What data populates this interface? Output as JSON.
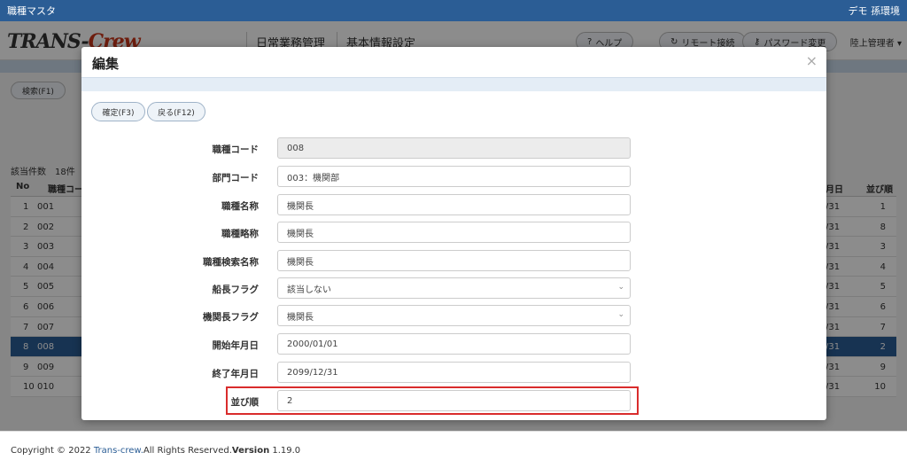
{
  "window": {
    "title": "職種マスタ",
    "env": "デモ 孫環境"
  },
  "header": {
    "logo_a": "TRANS-",
    "logo_b": "Crew",
    "nav": [
      "日常業務管理",
      "基本情報設定"
    ],
    "buttons": [
      {
        "icon": "help-icon",
        "glyph": "?",
        "label": "ヘルプ"
      },
      {
        "icon": "refresh-icon",
        "glyph": "↻",
        "label": "リモート接続"
      },
      {
        "icon": "key-icon",
        "glyph": "⚷",
        "label": "パスワード変更"
      }
    ],
    "user": "陸上管理者 ▾"
  },
  "background": {
    "search_button": "検索(F1)",
    "count": "該当件数　18件",
    "columns": {
      "no": "No",
      "code": "職種コー",
      "end": "月日",
      "order": "並び順"
    },
    "rows": [
      {
        "no": "1",
        "code": "001",
        "end": "/31",
        "order": "1"
      },
      {
        "no": "2",
        "code": "002",
        "end": "/31",
        "order": "8"
      },
      {
        "no": "3",
        "code": "003",
        "end": "/31",
        "order": "3"
      },
      {
        "no": "4",
        "code": "004",
        "end": "/31",
        "order": "4"
      },
      {
        "no": "5",
        "code": "005",
        "end": "/31",
        "order": "5"
      },
      {
        "no": "6",
        "code": "006",
        "end": "/31",
        "order": "6"
      },
      {
        "no": "7",
        "code": "007",
        "end": "/31",
        "order": "7"
      },
      {
        "no": "8",
        "code": "008",
        "end": "/31",
        "order": "2",
        "selected": true
      },
      {
        "no": "9",
        "code": "009",
        "end": "/31",
        "order": "9"
      },
      {
        "no": "10",
        "code": "010",
        "end": "/31",
        "order": "10"
      }
    ],
    "footer": {
      "copy": "Copyright © 2022 ",
      "link": "Trans-crew.",
      "rights": "All Rights Reserved.",
      "version_label": "Version",
      "version": " 1.19.0"
    }
  },
  "modal": {
    "title": "編集",
    "close": "×",
    "confirm_button": "確定(F3)",
    "back_button": "戻る(F12)",
    "fields": {
      "code": {
        "label": "職種コード",
        "value": "008"
      },
      "dept": {
        "label": "部門コード",
        "value": "003：機関部"
      },
      "name": {
        "label": "職種名称",
        "value": "機関長"
      },
      "short": {
        "label": "職種略称",
        "value": "機関長"
      },
      "search": {
        "label": "職種検索名称",
        "value": "機関長"
      },
      "captain": {
        "label": "船長フラグ",
        "value": "該当しない"
      },
      "chief": {
        "label": "機関長フラグ",
        "value": "機関長"
      },
      "start": {
        "label": "開始年月日",
        "value": "2000/01/01"
      },
      "end": {
        "label": "終了年月日",
        "value": "2099/12/31"
      },
      "order": {
        "label": "並び順",
        "value": "2"
      }
    }
  }
}
